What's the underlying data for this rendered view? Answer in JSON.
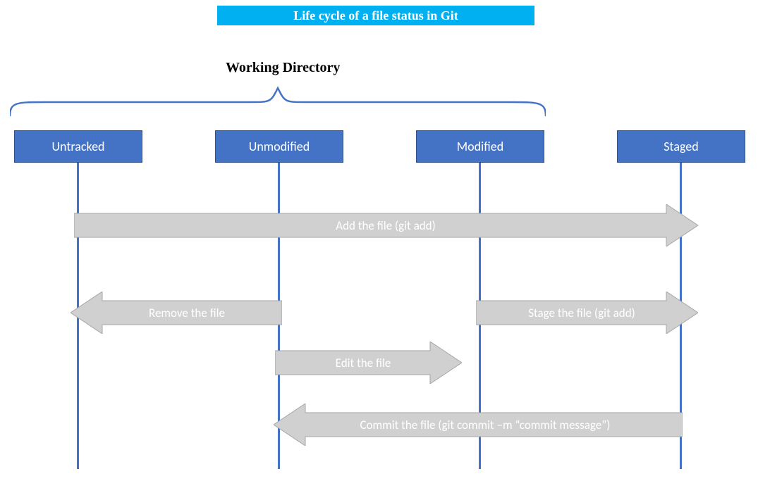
{
  "title": "Life cycle of a file status in Git",
  "group_label": "Working Directory",
  "states": {
    "untracked": "Untracked",
    "unmodified": "Unmodified",
    "modified": "Modified",
    "staged": "Staged"
  },
  "arrows": {
    "add": "Add the file (git add)",
    "remove": "Remove the file",
    "stage": "Stage the file (git add)",
    "edit": "Edit the file",
    "commit": "Commit the file (git commit –m “commit message”)"
  },
  "colors": {
    "title_bg": "#00B0F0",
    "box_bg": "#4472C4",
    "box_border": "#2F528F",
    "arrow_bg": "#D0D0D0",
    "arrow_border": "#A6A6A6"
  }
}
